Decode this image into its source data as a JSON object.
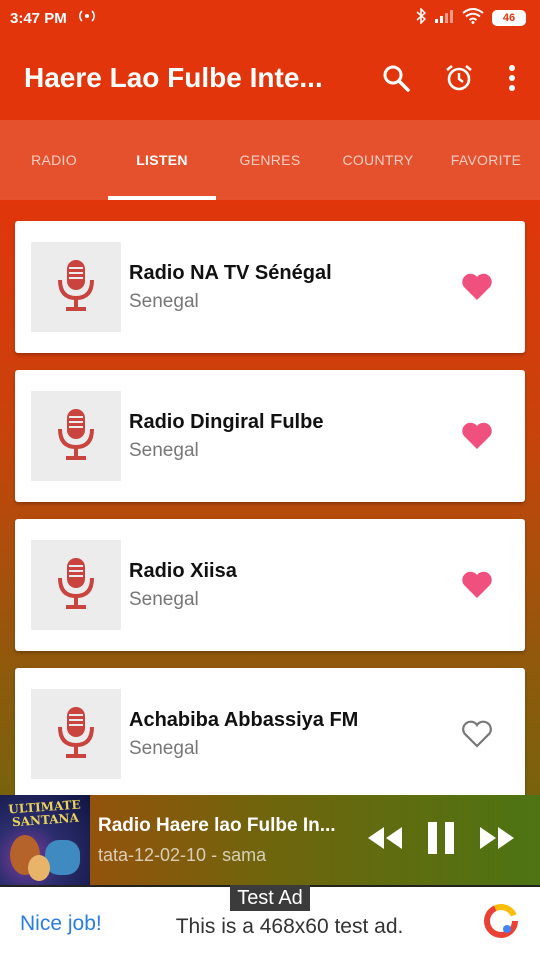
{
  "status_bar": {
    "time": "3:47 PM",
    "battery": "46",
    "colors": {
      "text": "#ffffff"
    }
  },
  "app_bar": {
    "title": "Haere Lao Fulbe Inte...",
    "icons": [
      "search-icon",
      "alarm-icon",
      "more-vert-icon"
    ]
  },
  "tabs": [
    {
      "label": "RADIO",
      "active": false
    },
    {
      "label": "LISTEN",
      "active": true
    },
    {
      "label": "GENRES",
      "active": false
    },
    {
      "label": "COUNTRY",
      "active": false
    },
    {
      "label": "FAVORITE",
      "active": false
    }
  ],
  "stations": [
    {
      "name": "Radio NA TV Sénégal",
      "country": "Senegal",
      "favorite": true
    },
    {
      "name": "Radio Dingiral Fulbe",
      "country": "Senegal",
      "favorite": true
    },
    {
      "name": "Radio Xiisa",
      "country": "Senegal",
      "favorite": true
    },
    {
      "name": "Achabiba Abbassiya FM",
      "country": "Senegal",
      "favorite": false
    }
  ],
  "player": {
    "title": "Radio Haere lao Fulbe In...",
    "subtitle": "tata-12-02-10 - sama",
    "album_art_text": "ULTIMATE SANTANA",
    "controls": [
      "rewind-icon",
      "pause-icon",
      "fast-forward-icon"
    ]
  },
  "ad": {
    "label": "Test Ad",
    "nice": "Nice job!",
    "text": "This is a 468x60 test ad."
  },
  "colors": {
    "accent_red": "#e2350b",
    "heart_pink": "#f0507e",
    "mic_red": "#c9433f",
    "link_blue": "#2a7de1"
  }
}
